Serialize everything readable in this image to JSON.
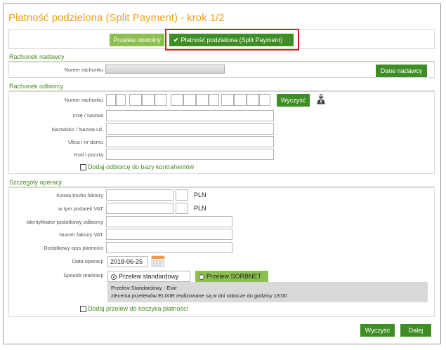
{
  "title": "Płatność podzielona (Split Payment) - krok 1/2",
  "tabs": {
    "free_transfer": "Przelew dowolny",
    "split_payment": "Płatność podzielona (Split Payment)",
    "check_glyph": "✔"
  },
  "sender": {
    "section_title": "Rachunek nadawcy",
    "account_label": "Numer rachunku",
    "sender_data_button": "Dane nadawcy"
  },
  "recipient": {
    "section_title": "Rachunek odbiorcy",
    "account_label": "Numer rachunku",
    "clear_button": "Wyczyść",
    "name_label": "Imię / Nazwa",
    "surname_label": "Nazwisko / Nazwa cd.",
    "street_label": "Ulica i nr domu",
    "postcode_label": "Kod i poczta",
    "add_to_contacts": "Dodaj odbiorcę do bazy kontrahentów",
    "contacts_icon": "person-icon"
  },
  "operation": {
    "section_title": "Szczegóły operacji",
    "gross_amount_label": "Kwota brutto faktury",
    "vat_label": "w tym podatek VAT",
    "currency": "PLN",
    "tax_id_label": "Identyfikator podatkowy odbiorcy",
    "invoice_number_label": "Numer faktury VAT",
    "description_label": "Dodatkowy opis płatności",
    "date_label": "Data operacji",
    "date_value": "2018-06-25",
    "calendar_icon": "calendar-icon",
    "method_label": "Sposób realizacji",
    "method_standard": "Przelew standardowy",
    "method_sorbnet": "Przelew SORBNET",
    "method_standard_selected": true,
    "info_line1": "Przelew Standardowy - Eixir",
    "info_line2": "zlecenia przelewów ELIXIR realizowane są w dni robocze do godziny 18:00",
    "add_to_basket": "Dodaj przelew do koszyka płatności"
  },
  "footer": {
    "clear_button": "Wyczyść",
    "next_button": "Dalej"
  },
  "colors": {
    "title_orange": "#f0a018",
    "green_dark": "#3f8e25",
    "green_light": "#8cc04e",
    "highlight_red": "#d62020"
  }
}
